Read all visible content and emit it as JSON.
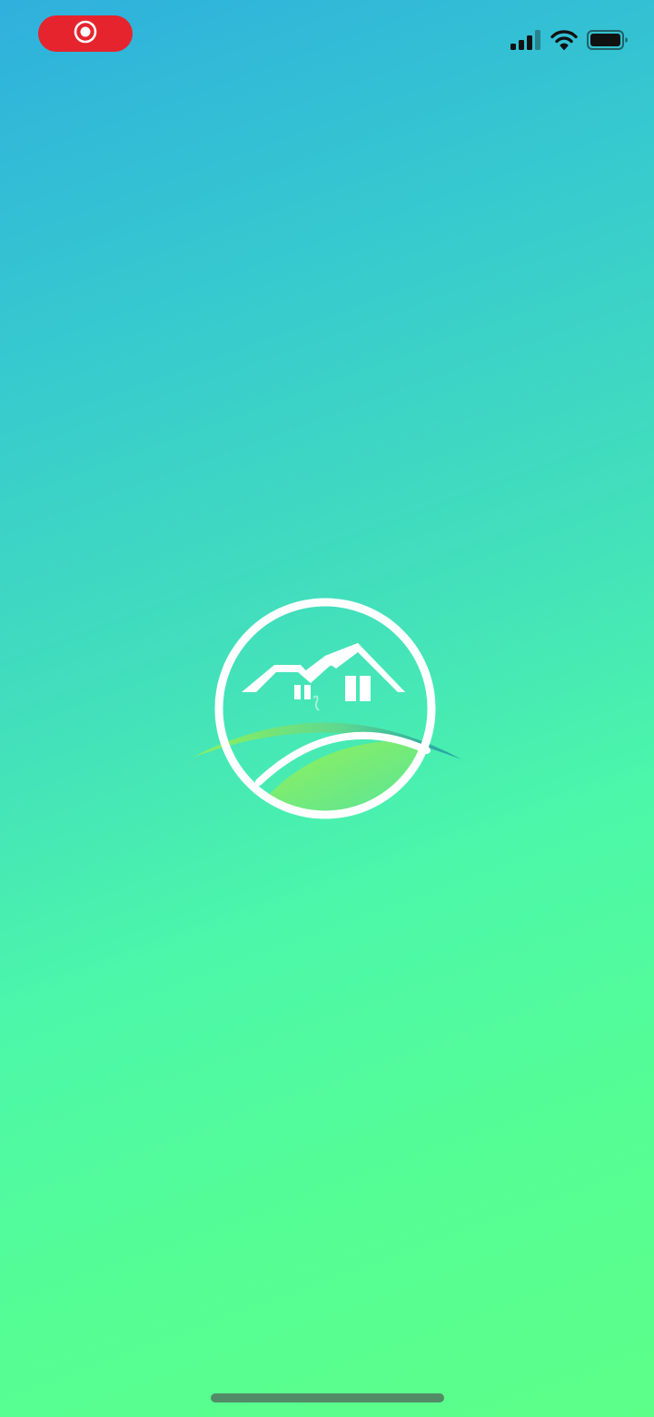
{
  "app": {
    "logo_icon": "house-on-hill-logo-icon"
  },
  "status_bar": {
    "recording_icon": "screen-recording-icon",
    "icons": [
      "cellular-signal-icon",
      "wifi-icon",
      "battery-icon"
    ],
    "recording_color": "#e5242d"
  },
  "colors": {
    "gradient_top": "#2fb0dd",
    "gradient_bottom": "#5cff88",
    "logo_green": "#8ef25a"
  }
}
